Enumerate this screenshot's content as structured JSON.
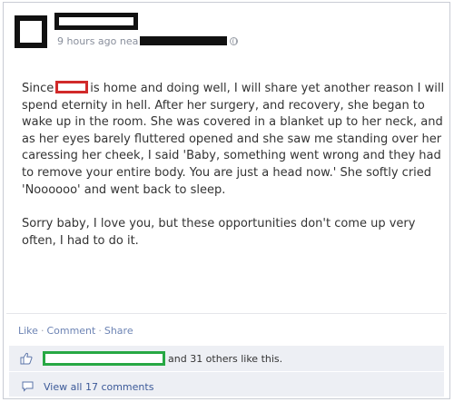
{
  "post": {
    "timestamp": "9 hours ago nea",
    "message_parts": {
      "p1_before": "Since",
      "p1_after": "is home and doing well, I will share yet another reason I will spend eternity in hell. After her surgery, and recovery, she began to wake up in the room. She was covered in a blanket up to her neck, and as her eyes barely fluttered opened and she saw me standing over her caressing her cheek, I said 'Baby, something went wrong and they had to remove your entire body. You are just a head now.' She softly cried 'Noooooo' and went back to sleep.",
      "p2": "Sorry baby, I love you, but these opportunities don't come up very often, I had to do it."
    },
    "actions": {
      "like": "Like",
      "comment": "Comment",
      "share": "Share",
      "separator": "·"
    },
    "likes_text": "and 31 others like this.",
    "view_comments": "View all 17 comments"
  },
  "icons": {
    "privacy": "globe-icon",
    "like": "thumbs-up-icon",
    "comments": "comment-bubble-icon"
  },
  "colors": {
    "link": "#3b5998",
    "action_link": "#6d84b4",
    "ufi_background": "#edeff4",
    "name_redaction": "#d12a2a",
    "liker_redaction": "#27a844"
  }
}
